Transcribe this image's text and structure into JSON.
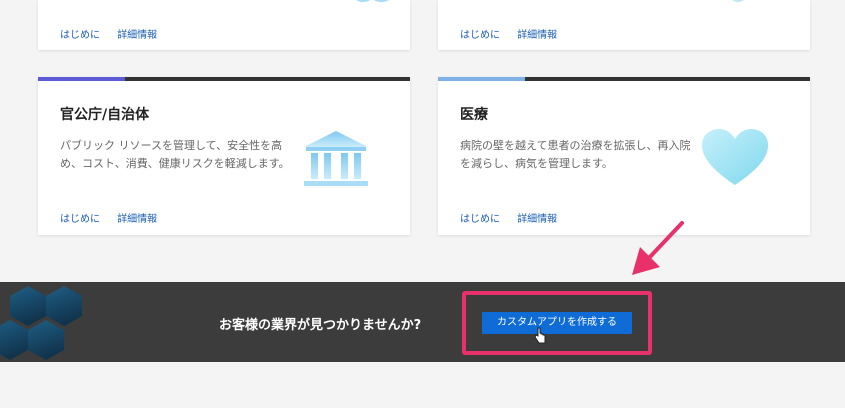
{
  "cards_top": [
    {
      "links": [
        "はじめに",
        "詳細情報"
      ]
    },
    {
      "links": [
        "はじめに",
        "詳細情報"
      ]
    }
  ],
  "cards": [
    {
      "title": "官公庁/自治体",
      "description": "パブリック リソースを管理して、安全性を高め、コスト、消費、健康リスクを軽減します。",
      "links": [
        "はじめに",
        "詳細情報"
      ],
      "icon": "building-icon",
      "accent_color": "#5b5bd6"
    },
    {
      "title": "医療",
      "description": "病院の壁を越えて患者の治療を拡張し、再入院を減らし、病気を管理します。",
      "links": [
        "はじめに",
        "詳細情報"
      ],
      "icon": "heart-icon",
      "accent_color": "#7fb0e6"
    }
  ],
  "banner": {
    "text": "お客様の業界が見つかりませんか?",
    "button_label": "カスタムアプリを作成する"
  },
  "colors": {
    "link": "#1a5fb4",
    "button": "#0f6cd6",
    "highlight": "#e8306b",
    "banner_bg": "#3c3c3c"
  }
}
